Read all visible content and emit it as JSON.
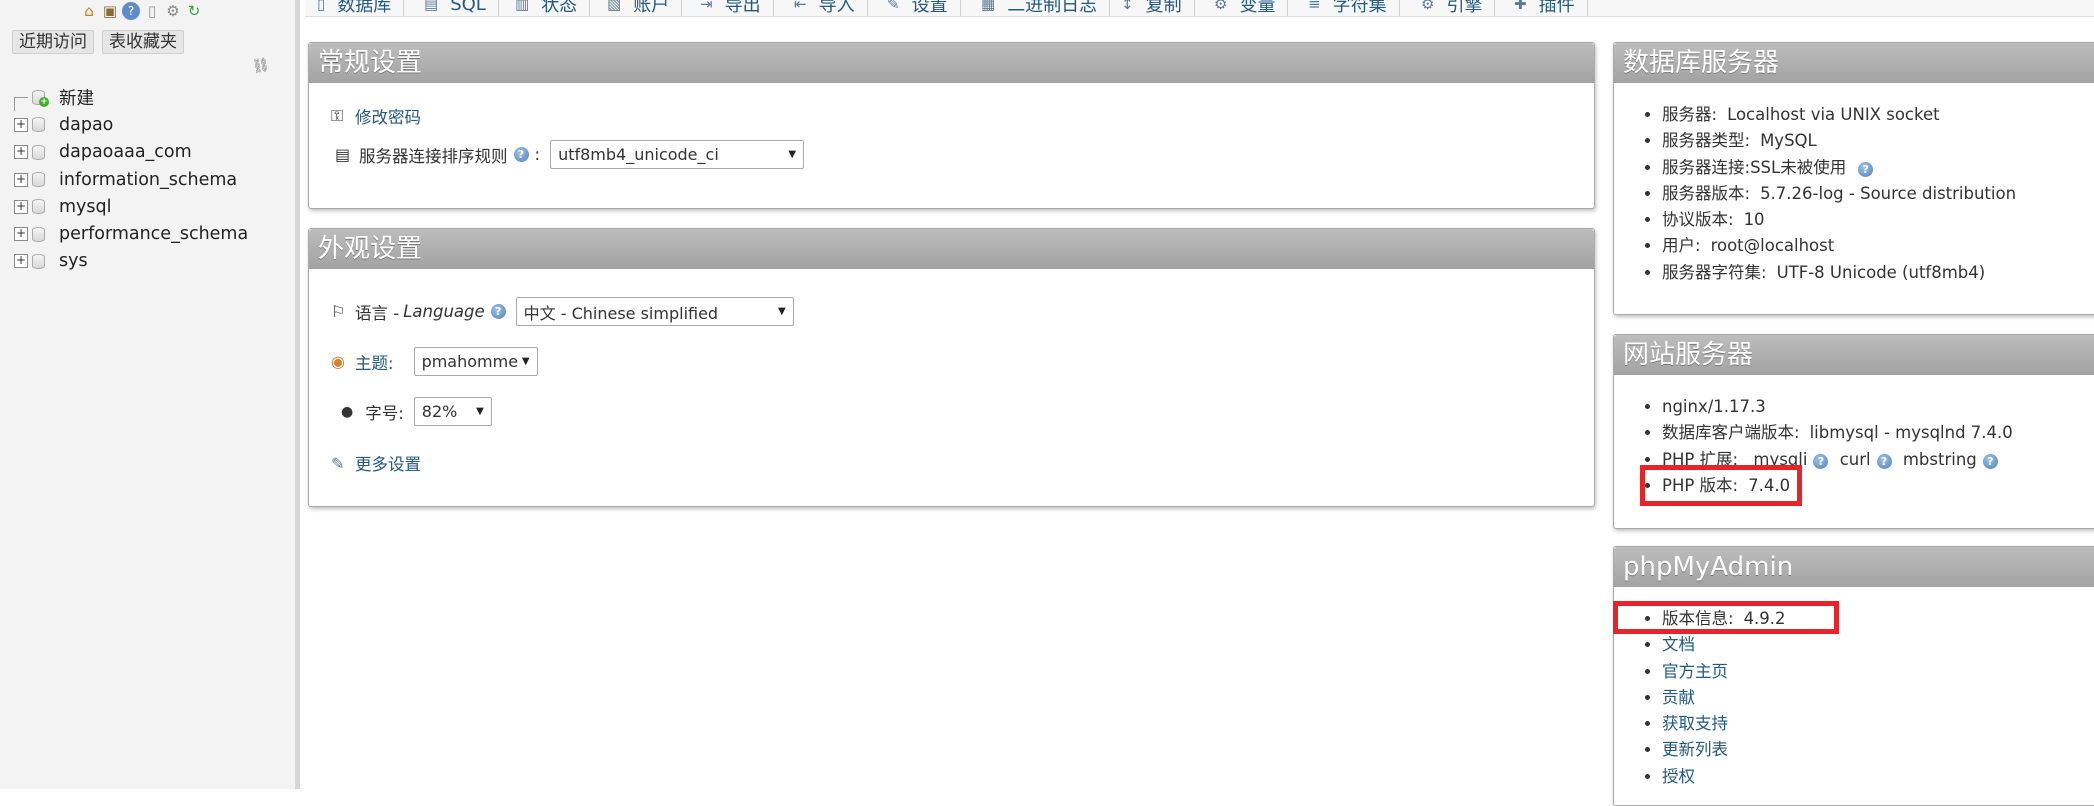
{
  "nav": {
    "icons": [
      "home-icon",
      "exit-icon",
      "help-icon",
      "docs-icon",
      "settings-icon",
      "reload-icon"
    ],
    "tabs": [
      "近期访问",
      "表收藏夹"
    ],
    "tree": [
      {
        "label": "新建",
        "type": "new"
      },
      {
        "label": "dapao",
        "type": "db"
      },
      {
        "label": "dapaoaaa_com",
        "type": "db"
      },
      {
        "label": "information_schema",
        "type": "db"
      },
      {
        "label": "mysql",
        "type": "db"
      },
      {
        "label": "performance_schema",
        "type": "db"
      },
      {
        "label": "sys",
        "type": "db"
      }
    ]
  },
  "top_tabs": [
    "数据库",
    "SQL",
    "状态",
    "账户",
    "导出",
    "导入",
    "设置",
    "二进制日志",
    "复制",
    "变量",
    "字符集",
    "引擎",
    "插件"
  ],
  "general": {
    "title": "常规设置",
    "change_password": "修改密码",
    "collation_label": "服务器连接排序规则",
    "collation_value": "utf8mb4_unicode_ci"
  },
  "appearance": {
    "title": "外观设置",
    "language_label": "语言 - ",
    "language_label_italic": "Language",
    "language_value": "中文 - Chinese simplified",
    "theme_label": "主题:",
    "theme_value": "pmahomme",
    "fontsize_label": "字号:",
    "fontsize_value": "82%",
    "more_settings": "更多设置"
  },
  "db_server": {
    "title": "数据库服务器",
    "items": [
      {
        "label": "服务器:",
        "value": "Localhost via UNIX socket"
      },
      {
        "label": "服务器类型:",
        "value": "MySQL"
      },
      {
        "label": "服务器连接:",
        "value": "SSL未被使用"
      },
      {
        "label": "服务器版本:",
        "value": "5.7.26-log - Source distribution"
      },
      {
        "label": "协议版本:",
        "value": "10"
      },
      {
        "label": "用户:",
        "value": "root@localhost"
      },
      {
        "label": "服务器字符集:",
        "value": "UTF-8 Unicode (utf8mb4)"
      }
    ]
  },
  "web_server": {
    "title": "网站服务器",
    "nginx": "nginx/1.17.3",
    "client_label": "数据库客户端版本:",
    "client_value": "libmysql - mysqlnd 7.4.0",
    "ext_label": "PHP 扩展:",
    "ext_values": [
      "mysqli",
      "curl",
      "mbstring"
    ],
    "php_label": "PHP 版本:",
    "php_value": "7.4.0"
  },
  "pma": {
    "title": "phpMyAdmin",
    "version_label": "版本信息:",
    "version_value": "4.9.2",
    "links": [
      "文档",
      "官方主页",
      "贡献",
      "获取支持",
      "更新列表",
      "授权"
    ]
  },
  "colors": {
    "link": "#235a81",
    "panel_header": "#a9a9a9",
    "highlight": "#e8232a"
  }
}
